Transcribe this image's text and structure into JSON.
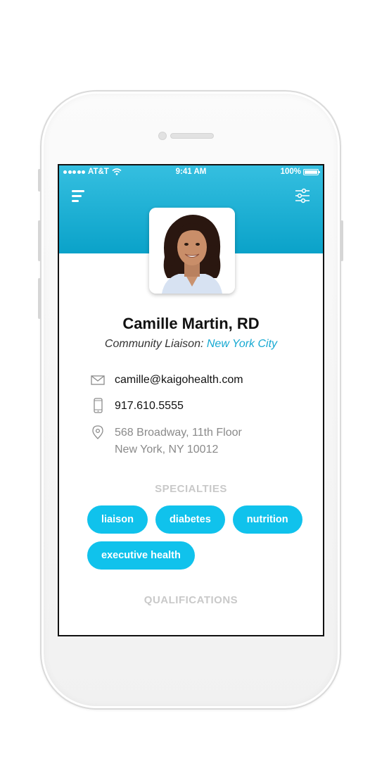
{
  "status_bar": {
    "carrier": "AT&T",
    "time": "9:41 AM",
    "battery": "100%"
  },
  "profile": {
    "name": "Camille Martin, RD",
    "role_label": "Community Liaison:",
    "city": "New York City"
  },
  "contact": {
    "email": "camille@kaigohealth.com",
    "phone": "917.610.5555",
    "address_line1": "568 Broadway, 11th Floor",
    "address_line2": "New York, NY 10012"
  },
  "specialties": {
    "title": "SPECIALTIES",
    "items": [
      "liaison",
      "diabetes",
      "nutrition",
      "executive health"
    ]
  },
  "qualifications": {
    "title": "QUALIFICATIONS"
  },
  "colors": {
    "header_top": "#35bfe0",
    "header_bottom": "#0aa2c9",
    "accent": "#10c2ec",
    "city_link": "#16a9d2",
    "section_title": "#c9c9c9"
  },
  "icons": [
    "menu-icon",
    "filter-icon",
    "mail-icon",
    "phone-icon",
    "location-pin-icon",
    "wifi-icon",
    "battery-icon",
    "signal-dots-icon"
  ]
}
